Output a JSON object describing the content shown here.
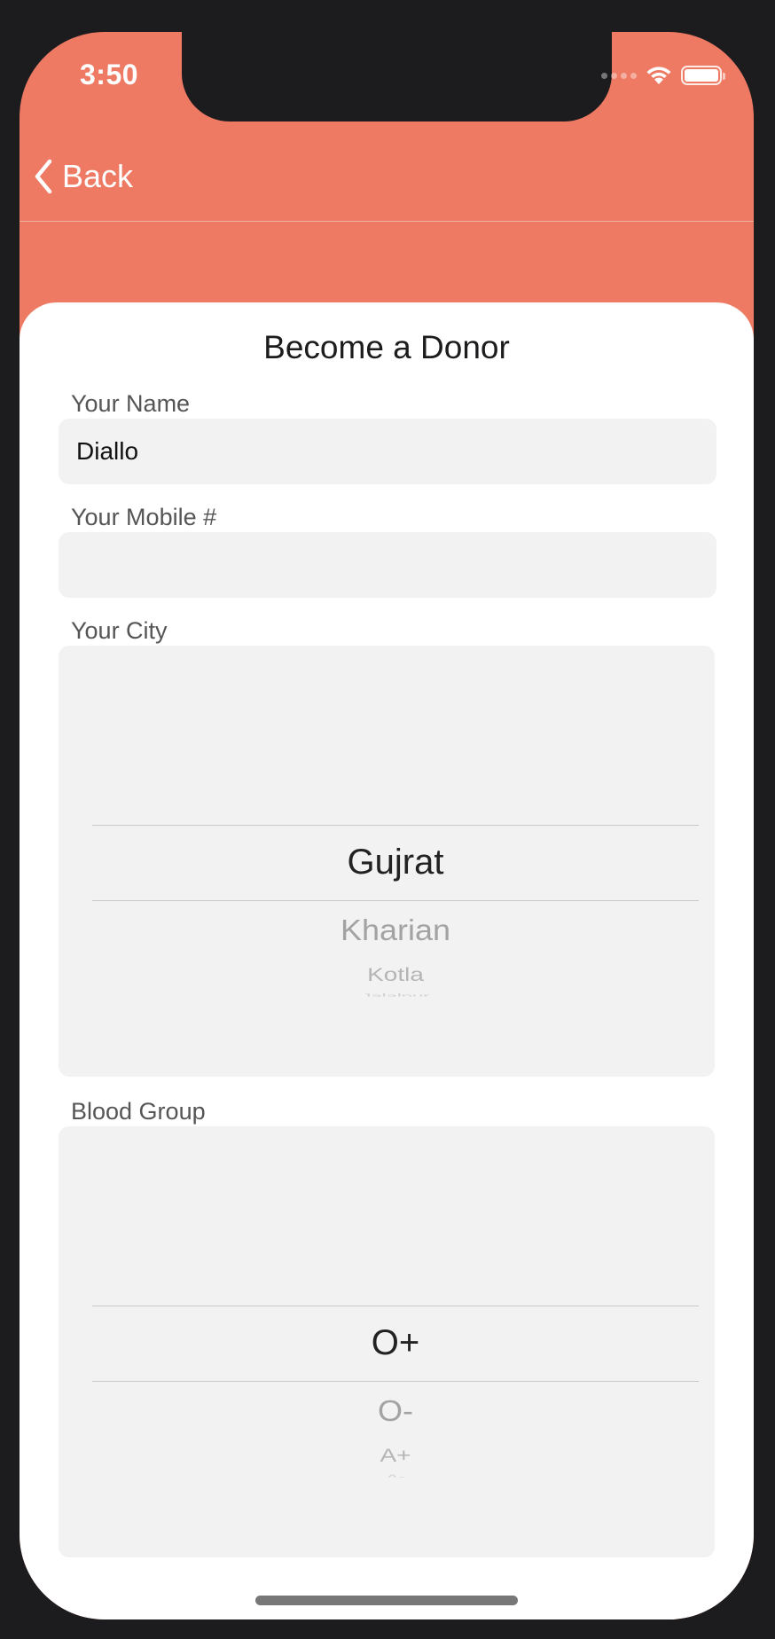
{
  "status_bar": {
    "time": "3:50"
  },
  "nav": {
    "back_label": "Back"
  },
  "form": {
    "title": "Become a Donor",
    "name": {
      "label": "Your Name",
      "value": "Diallo"
    },
    "mobile": {
      "label": "Your Mobile #",
      "value": ""
    },
    "city": {
      "label": "Your City",
      "selected": "Gujrat",
      "options_below": [
        "Kharian",
        "Kotla",
        "Jalalpur"
      ]
    },
    "blood_group": {
      "label": "Blood Group",
      "selected": "O+",
      "options_below": [
        "O-",
        "A+",
        "A-"
      ]
    }
  },
  "colors": {
    "accent": "#ee7a64",
    "field_background": "#f2f2f2"
  }
}
